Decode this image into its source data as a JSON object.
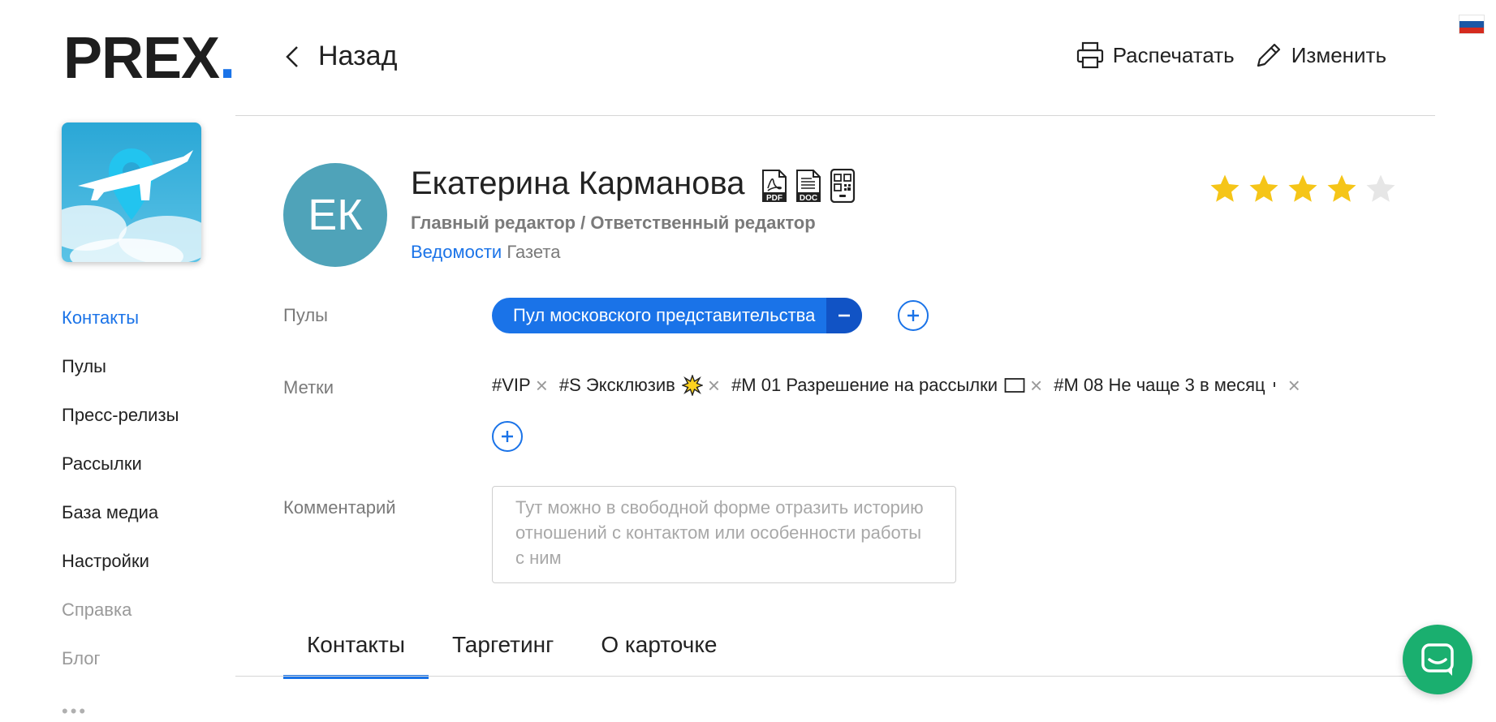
{
  "brand": {
    "logo_text": "PREX",
    "logo_dot": ".",
    "accent": "#1a73e8"
  },
  "locale": {
    "flag": "ru-flag",
    "colors": [
      "#ffffff",
      "#1c57a5",
      "#d52b1e"
    ]
  },
  "sidebar": {
    "app_image": "airplane-location-image",
    "items": [
      {
        "label": "Контакты",
        "state": "active"
      },
      {
        "label": "Пулы",
        "state": "normal"
      },
      {
        "label": "Пресс-релизы",
        "state": "normal"
      },
      {
        "label": "Рассылки",
        "state": "normal"
      },
      {
        "label": "База медиа",
        "state": "normal"
      },
      {
        "label": "Настройки",
        "state": "normal"
      },
      {
        "label": "Справка",
        "state": "muted"
      },
      {
        "label": "Блог",
        "state": "muted"
      }
    ],
    "more": "•••"
  },
  "header": {
    "back_label": "Назад",
    "print_label": "Распечатать",
    "edit_label": "Изменить"
  },
  "contact": {
    "initials": "ЕК",
    "avatar_color": "#4fa3b9",
    "name": "Екатерина Карманова",
    "export_icons": [
      "pdf-icon",
      "doc-icon",
      "qr-code-icon"
    ],
    "export_labels": {
      "pdf": "PDF",
      "doc": "DOC"
    },
    "position": "Главный редактор / Ответственный редактор",
    "org_name": "Ведомости",
    "org_type": "Газета",
    "rating": 4,
    "rating_max": 5,
    "star_color": "#f5c518"
  },
  "fields": {
    "pools_label": "Пулы",
    "pools": [
      "Пул московского представительства"
    ],
    "tags_label": "Метки",
    "tags": [
      {
        "text": "#VIP",
        "emoji": ""
      },
      {
        "text": "#S Эксклюзив",
        "emoji": "💥"
      },
      {
        "text": "#M 01 Разрешение на рассылки",
        "emoji": "✉"
      },
      {
        "text": "#M 08 Не чаще 3 в месяц",
        "emoji": "⏱"
      }
    ],
    "comment_label": "Комментарий",
    "comment_placeholder": "Тут можно в свободной форме отразить историю отношений с контактом или особенности работы с ним"
  },
  "tabs": [
    {
      "label": "Контакты",
      "active": true
    },
    {
      "label": "Таргетинг",
      "active": false
    },
    {
      "label": "О карточке",
      "active": false
    }
  ],
  "chat": {
    "icon": "chat-icon",
    "color": "#1aaf6f"
  }
}
